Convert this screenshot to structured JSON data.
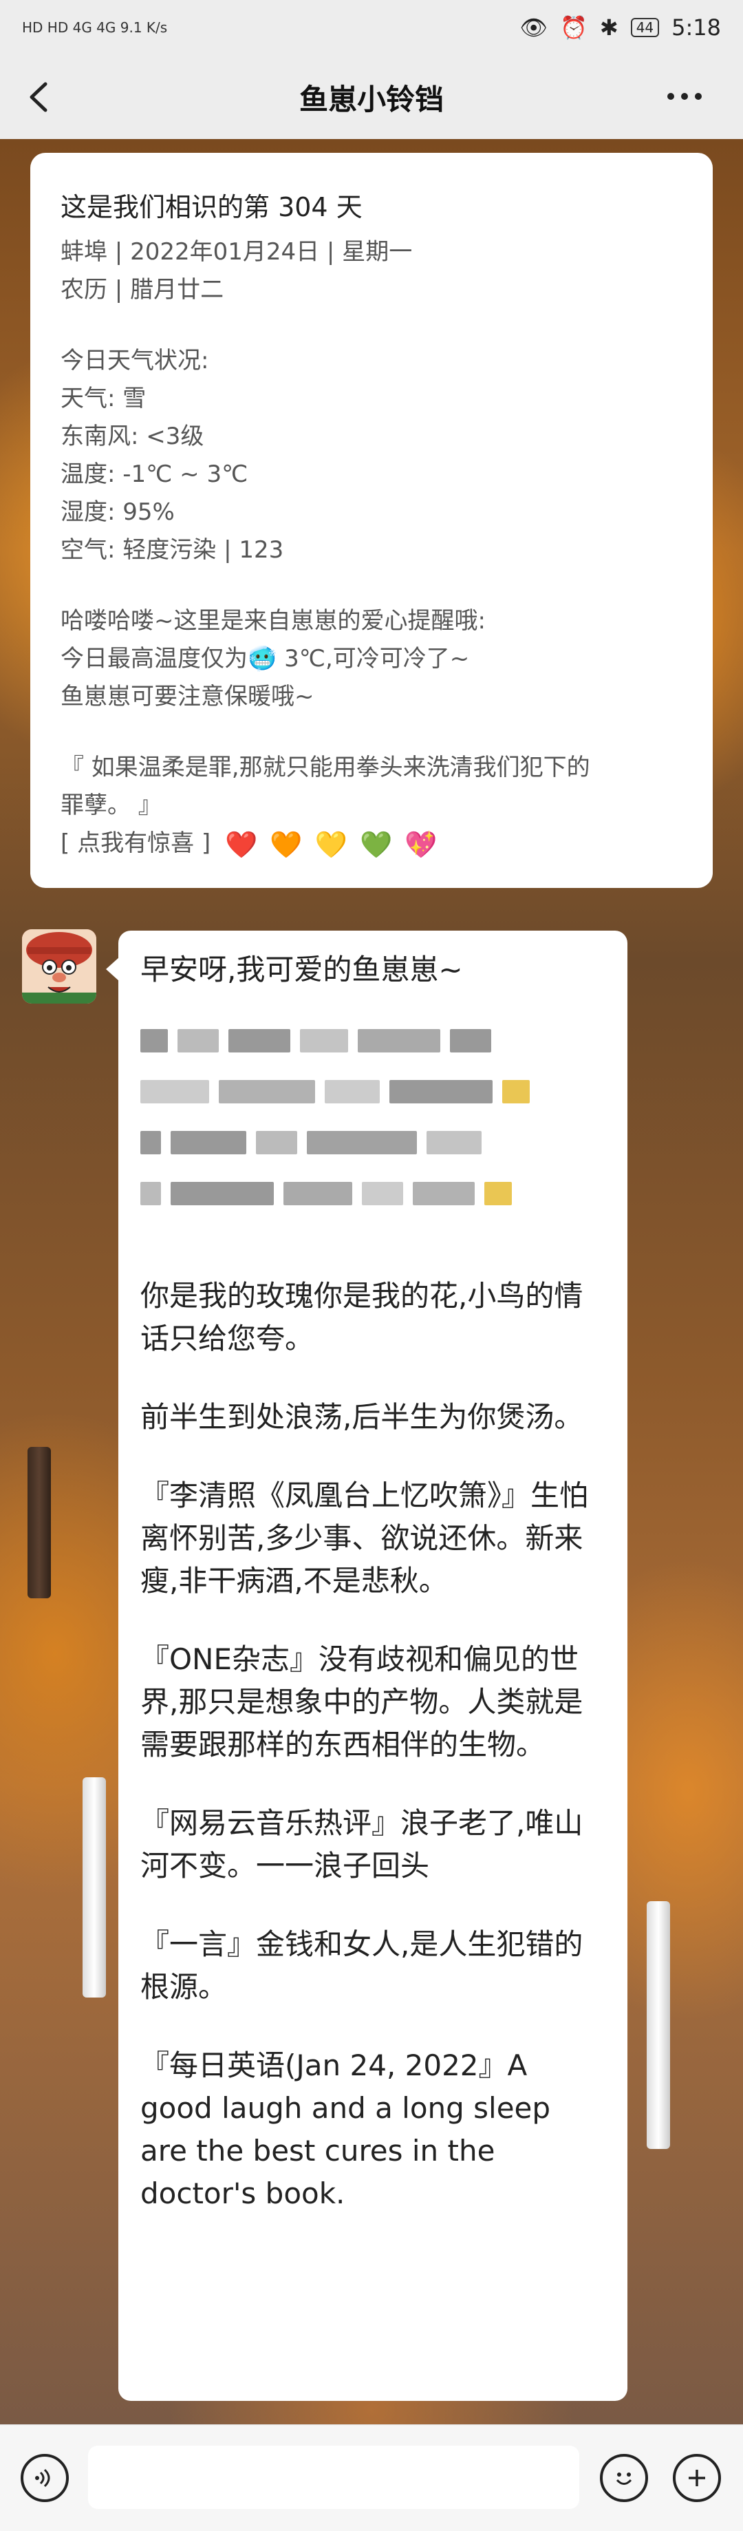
{
  "status_bar": {
    "left": "HD HD 4G 4G 9.1 K/s",
    "time": "5:18",
    "battery": "44"
  },
  "header": {
    "title": "鱼崽小铃铛"
  },
  "card": {
    "title": "这是我们相识的第 304 天",
    "date_line": "蚌埠 | 2022年01月24日 | 星期一",
    "lunar_line": "农历 | 腊月廿二",
    "weather_heading": "今日天气状况:",
    "weather": "天气: 雪",
    "wind": "东南风: <3级",
    "temperature": "温度: -1℃ ~ 3℃",
    "humidity": "湿度: 95%",
    "air": "空气: 轻度污染 | 123",
    "reminder_1": "哈喽哈喽~这里是来自崽崽的爱心提醒哦:",
    "reminder_2": "今日最高温度仅为🥶 3℃,可冷可冷了~",
    "reminder_3": "鱼崽崽可要注意保暖哦~",
    "quote_1": "『 如果温柔是罪,那就只能用拳头来洗清我们犯下的",
    "quote_2": "罪孽。 』",
    "surprise_link": "[ 点我有惊喜 ]",
    "hearts": [
      "❤️",
      "🧡",
      "💛",
      "💚",
      "💖"
    ]
  },
  "message": {
    "greeting": "早安呀,我可爱的鱼崽崽~",
    "p1": "你是我的玫瑰你是我的花,小鸟的情话只给您夸。",
    "p2": "前半生到处浪荡,后半生为你煲汤。",
    "p3": "『李清照《凤凰台上忆吹箫》』生怕离怀别苦,多少事、欲说还休。新来瘦,非干病酒,不是悲秋。",
    "p4": "『ONE杂志』没有歧视和偏见的世界,那只是想象中的产物。人类就是需要跟那样的东西相伴的生物。",
    "p5": "『网易云音乐热评』浪子老了,唯山河不变。一一浪子回头",
    "p6": "『一言』金钱和女人,是人生犯错的根源。",
    "p7": "『每日英语(Jan 24, 2022』A good laugh and a long sleep are the best cures in the doctor's book."
  },
  "bottom": {
    "voice": "voice-icon",
    "emoji": "emoji-icon",
    "plus": "plus-icon"
  }
}
